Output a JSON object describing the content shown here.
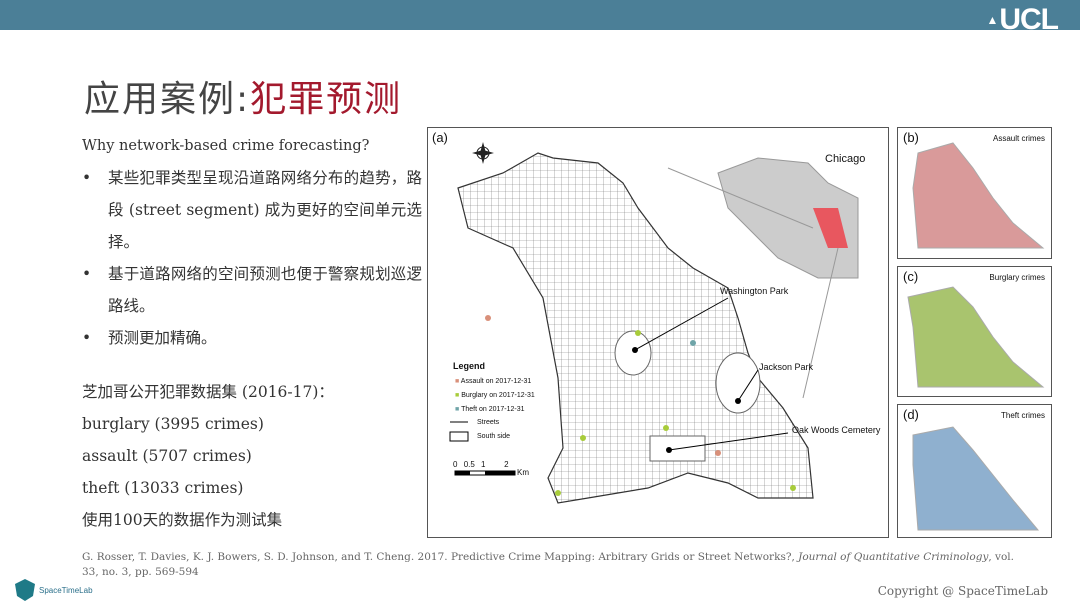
{
  "header": {
    "logo": "UCL",
    "bar_color": "#4b7f97"
  },
  "title": {
    "prefix": "应用案例:",
    "highlight": "犯罪预测",
    "highlight_color": "#a3192d"
  },
  "content": {
    "question": "Why network-based crime forecasting?",
    "bullets": [
      "某些犯罪类型呈现沿道路网络分布的趋势，路段 (street segment) 成为更好的空间单元选择。",
      "基于道路网络的空间预测也便于警察规划巡逻路线。",
      "预测更加精确。"
    ],
    "dataset_title": "芝加哥公开犯罪数据集 (2016-17)：",
    "datasets": [
      "burglary (3995 crimes)",
      "assault (5707 crimes)",
      "theft (13033 crimes)"
    ],
    "test_note": "使用100天的数据作为测试集"
  },
  "figure": {
    "panel_a": {
      "label": "(a)",
      "city": "Chicago",
      "places": [
        "Washington Park",
        "Jackson Park",
        "Oak Woods Cemetery"
      ],
      "legend": {
        "title": "Legend",
        "items": [
          {
            "label": "Assault on 2017-12-31",
            "color": "#d9907a"
          },
          {
            "label": "Burglary on 2017-12-31",
            "color": "#a8cc3a"
          },
          {
            "label": "Theft on 2017-12-31",
            "color": "#6fa4a8"
          },
          {
            "label": "Streets"
          },
          {
            "label": "South side"
          }
        ]
      },
      "scale": {
        "ticks": [
          "0",
          "0.5",
          "1",
          "2"
        ],
        "unit": "Km"
      }
    },
    "panel_b": {
      "label": "(b)",
      "title": "Assault crimes",
      "color": "#d99a9a"
    },
    "panel_c": {
      "label": "(c)",
      "title": "Burglary crimes",
      "color": "#a9c46e"
    },
    "panel_d": {
      "label": "(d)",
      "title": "Theft crimes",
      "color": "#8fb0cf"
    }
  },
  "footer": {
    "reference": "G. Rosser, T. Davies, K. J. Bowers, S. D. Johnson, and T. Cheng. 2017. Predictive Crime Mapping: Arbitrary Grids or Street Networks?,",
    "journal": "Journal of Quantitative Criminology",
    "ref_tail": ", vol. 33, no. 3, pp. 569-594",
    "lab_logo": "SpaceTimeLab",
    "copyright": "Copyright @ SpaceTimeLab"
  }
}
